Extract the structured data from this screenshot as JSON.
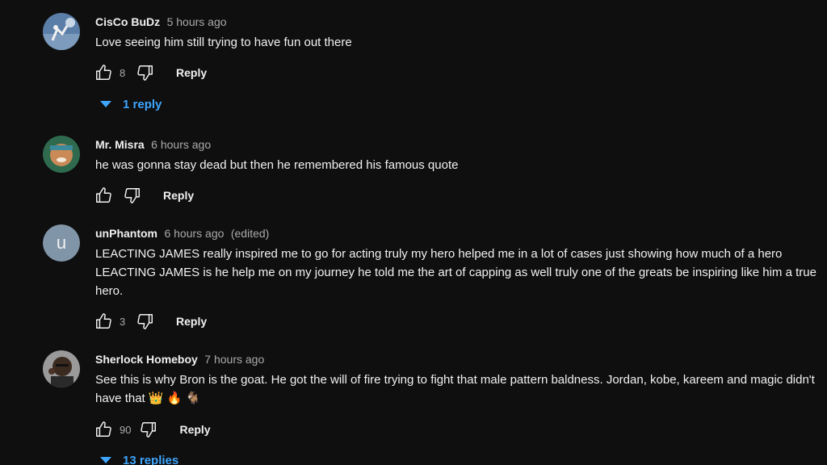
{
  "comments": [
    {
      "author": "CisCo BuDz",
      "time": "5 hours ago",
      "text": "Love seeing him still trying to have fun out there",
      "likes": "8",
      "reply_label": "Reply",
      "replies_label": "1 reply"
    },
    {
      "author": "Mr. Misra",
      "time": "6 hours ago",
      "text": "he was gonna stay dead but then he remembered his famous quote",
      "likes": "",
      "reply_label": "Reply"
    },
    {
      "author": "unPhantom",
      "time": "6 hours ago",
      "edited": "(edited)",
      "avatar_letter": "u",
      "text": "LEACTING JAMES really inspired me to go for acting truly my hero helped me in a lot of cases just showing how much of a hero LEACTING JAMES is he help me on my journey he told me the art of capping as well truly one of the greats be inspiring like him a true hero.",
      "likes": "3",
      "reply_label": "Reply"
    },
    {
      "author": "Sherlock Homeboy",
      "time": "7 hours ago",
      "text": "See this is why Bron is the goat. He got the will of fire trying to fight that male pattern baldness. Jordan, kobe, kareem and magic didn't have that",
      "emojis": [
        "👑",
        "🔥",
        "🐐"
      ],
      "likes": "90",
      "reply_label": "Reply",
      "replies_label": "13 replies"
    }
  ],
  "colors": {
    "background": "#0f0f0f",
    "link_blue": "#3ea6ff",
    "secondary_text": "#aaaaaa"
  },
  "icons": [
    "thumbs-up-icon",
    "thumbs-down-icon",
    "caret-down-icon"
  ]
}
